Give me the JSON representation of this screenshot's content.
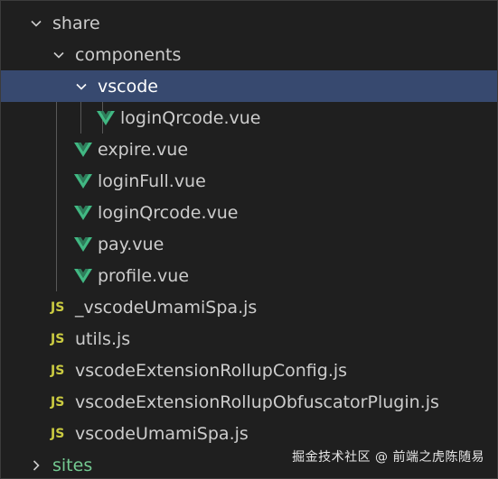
{
  "tree": {
    "share": {
      "label": "share",
      "expanded": true
    },
    "components": {
      "label": "components",
      "expanded": true
    },
    "vscode": {
      "label": "vscode",
      "expanded": true,
      "selected": true
    },
    "vscode_loginQrcode": {
      "label": "loginQrcode.vue",
      "icon": "vue-icon"
    },
    "expire": {
      "label": "expire.vue",
      "icon": "vue-icon"
    },
    "loginFull": {
      "label": "loginFull.vue",
      "icon": "vue-icon"
    },
    "loginQrcode": {
      "label": "loginQrcode.vue",
      "icon": "vue-icon"
    },
    "pay": {
      "label": "pay.vue",
      "icon": "vue-icon"
    },
    "profile": {
      "label": "profile.vue",
      "icon": "vue-icon"
    },
    "vscodeUmamiSpaPrivate": {
      "label": "_vscodeUmamiSpa.js",
      "icon": "js-icon",
      "badge": "JS"
    },
    "utils": {
      "label": "utils.js",
      "icon": "js-icon",
      "badge": "JS"
    },
    "rollupConfig": {
      "label": "vscodeExtensionRollupConfig.js",
      "icon": "js-icon",
      "badge": "JS"
    },
    "obfuscatorPlugin": {
      "label": "vscodeExtensionRollupObfuscatorPlugin.js",
      "icon": "js-icon",
      "badge": "JS"
    },
    "vscodeUmamiSpa": {
      "label": "vscodeUmamiSpa.js",
      "icon": "js-icon",
      "badge": "JS"
    },
    "sites": {
      "label": "sites",
      "expanded": false,
      "status_color": "#73c991"
    }
  },
  "watermark": "掘金技术社区 @ 前端之虎陈随易",
  "colors": {
    "background": "#1f1f1f",
    "selection": "#37496f",
    "text": "#cccccc",
    "vue_green": "#41b883",
    "vue_dark": "#2e7d5b",
    "js_yellow": "#cbcb41",
    "git_added": "#73c991"
  }
}
